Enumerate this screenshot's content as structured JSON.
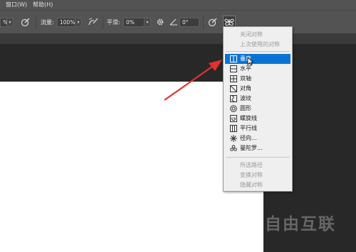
{
  "menubar": {
    "items": [
      "窗口(W)",
      "帮助(H)"
    ]
  },
  "options": {
    "opacity_value": "%",
    "flow_label": "流量:",
    "flow_value": "100%",
    "smoothing_label": "平滑:",
    "smoothing_value": "0%",
    "angle_value": "0°"
  },
  "symmetry_menu": {
    "top_items": [
      "关闭对称",
      "上次使用的对称"
    ],
    "items": [
      "垂直",
      "水平",
      "双轴",
      "对角",
      "波纹",
      "圆形",
      "螺旋线",
      "平行线",
      "径向...",
      "曼陀罗..."
    ],
    "highlighted_index": 0,
    "bottom_items": [
      "所选路径",
      "变换对称",
      "隐藏对称"
    ]
  },
  "watermark": "自由互联",
  "colors": {
    "highlight": "#0a74d4",
    "arrow": "#e53030",
    "panel": "#535353"
  }
}
